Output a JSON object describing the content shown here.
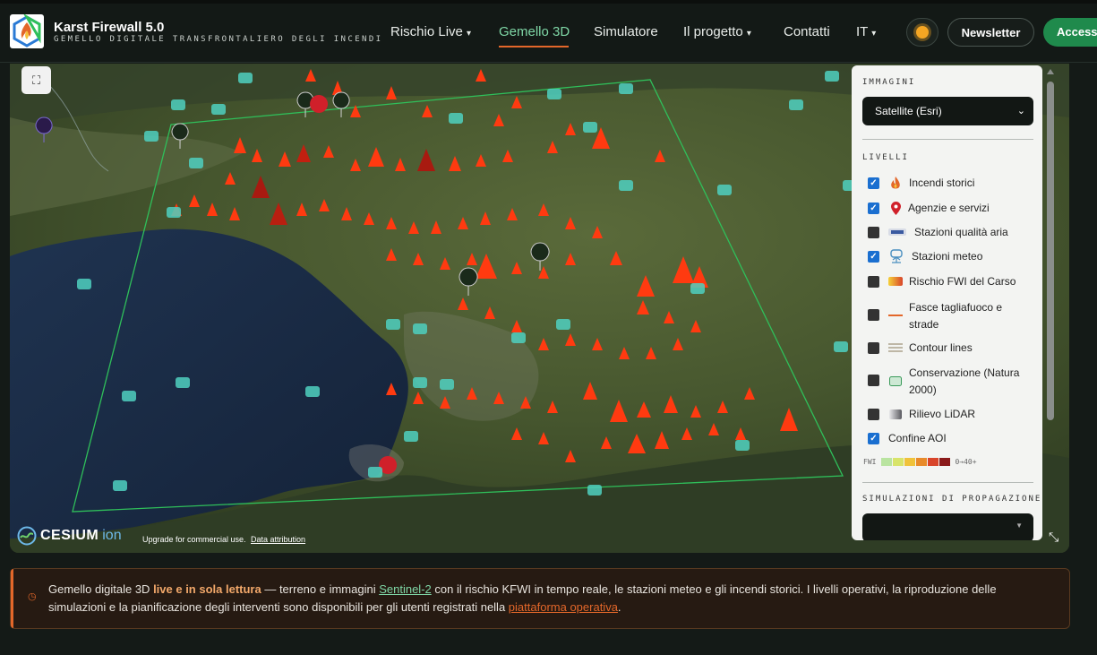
{
  "brand": {
    "title": "Karst Firewall 5.0",
    "subtitle": "GEMELLO DIGITALE TRANSFRONTALIERO DEGLI INCENDI"
  },
  "nav": {
    "items": [
      {
        "label": "Rischio Live",
        "caret": "▾"
      },
      {
        "label": "Gemello 3D",
        "active": true
      },
      {
        "label": "Simulatore"
      },
      {
        "label": "Il progetto",
        "caret": "▾"
      },
      {
        "label": "Contatti"
      },
      {
        "label": "IT",
        "caret": "▾"
      }
    ],
    "theme_icon": "sun-icon",
    "newsletter": "Newsletter",
    "access": "Accesso"
  },
  "map": {
    "fullscreen_icon": "fullscreen-icon",
    "cesium": {
      "brand": "CESIUM",
      "ion": "ion",
      "credit": "Upgrade for commercial use.",
      "data_attribution": "Data attribution"
    },
    "expand_icon": "expand-corners-icon"
  },
  "panel": {
    "imagery": {
      "label": "IMMAGINI",
      "selected": "Satellite (Esri)"
    },
    "layers": {
      "label": "LIVELLI",
      "items": [
        {
          "label": "Incendi storici",
          "checked": true,
          "icon": "flame-icon"
        },
        {
          "label": "Agenzie e servizi",
          "checked": true,
          "icon": "map-pin-icon"
        },
        {
          "label": "Stazioni qualità aria",
          "checked": false,
          "icon": "air-station-icon"
        },
        {
          "label": "Stazioni meteo",
          "checked": true,
          "icon": "weather-station-icon"
        },
        {
          "label": "Rischio FWI del Carso",
          "checked": false,
          "icon": "fwi-gradient-icon"
        },
        {
          "label": "Fasce tagliafuoco e strade",
          "label_line1": "Fasce tagliafuoco e",
          "label_line2": "strade",
          "checked": false,
          "icon": "firebreak-line-icon"
        },
        {
          "label": "Contour lines",
          "checked": false,
          "icon": "contour-lines-icon"
        },
        {
          "label": "Conservazione (Natura 2000)",
          "label_line1": "Conservazione (Natura",
          "label_line2": "2000)",
          "checked": false,
          "icon": "natura-2000-icon"
        },
        {
          "label": "Rilievo LiDAR",
          "checked": false,
          "icon": "lidar-gradient-icon"
        },
        {
          "label": "Confine AOI",
          "checked": true,
          "icon": ""
        }
      ]
    },
    "fwi_scale": {
      "label": "FWI",
      "range": "0→40+",
      "colors": [
        "#b9e4a0",
        "#d8e46a",
        "#f0c23a",
        "#e88a2a",
        "#d8452a",
        "#8a1a1a"
      ]
    },
    "simulations": {
      "label": "SIMULAZIONI DI PROPAGAZIONE",
      "selected": ""
    }
  },
  "banner": {
    "icon": "clock-icon",
    "t1": "Gemello digitale 3D ",
    "strong": "live e in sola lettura",
    "t2": " — terreno e immagini ",
    "link1": "Sentinel-2",
    "t3": " con il rischio KFWI in tempo reale, le stazioni meteo e gli incendi storici. I livelli operativi, la riproduzione delle simulazioni e la pianificazione degli interventi sono disponibili per gli utenti registrati nella ",
    "link2": "piattaforma operativa",
    "t4": "."
  },
  "colors": {
    "accent": "#e3672a",
    "active_nav": "#7fd7a6",
    "access_btn": "#1f8a4c",
    "sea": "#1d2e45",
    "aoi_line": "#2fbf5a",
    "fire": "#ff3a10"
  }
}
